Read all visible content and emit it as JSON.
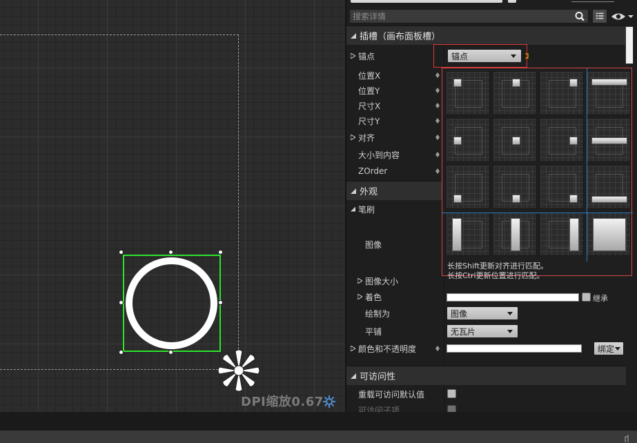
{
  "designer": {
    "dpi_label": "DPI缩放0.67",
    "settings_icon": "gear-icon",
    "anchor_icon": "anchor-flower-icon"
  },
  "details": {
    "search": {
      "placeholder": "搜索详情"
    },
    "icons": {
      "search": "search-icon",
      "view_options": "grid-icon",
      "visibility": "eye-icon"
    },
    "sections": {
      "slot": "插槽（画布面板槽）",
      "appearance": "外观",
      "accessibility": "可访问性"
    },
    "slot_rows": {
      "anchors": {
        "label": "锚点",
        "dropdown": "锚点"
      },
      "position_x": "位置X",
      "position_y": "位置Y",
      "size_x": "尺寸X",
      "size_y": "尺寸Y",
      "alignment": "对齐",
      "size_to_content": "大小到内容",
      "zorder": "ZOrder"
    },
    "appearance_rows": {
      "brush": "笔刷",
      "image": "图像",
      "image_size": "图像大小",
      "tint": {
        "label": "着色",
        "inherit_label": "继承"
      },
      "draw_as": {
        "label": "绘制为",
        "value": "图像"
      },
      "tiling": {
        "label": "平铺",
        "value": "无瓦片"
      },
      "color_and_opacity": {
        "label": "颜色和不透明度",
        "bind_button": "绑定"
      }
    },
    "accessibility_rows": {
      "override_defaults": "重载可访问默认值",
      "children_accessible": "可访问子项"
    }
  },
  "anchor_popup": {
    "hint_line1": "长按Shift更新对齐进行匹配。",
    "hint_line2": "长按Ctrl更新位置进行匹配。",
    "presets": [
      {
        "name": "anchor-top-left"
      },
      {
        "name": "anchor-top-center"
      },
      {
        "name": "anchor-top-right"
      },
      {
        "name": "anchor-top-stretch"
      },
      {
        "name": "anchor-center-left"
      },
      {
        "name": "anchor-center"
      },
      {
        "name": "anchor-center-right"
      },
      {
        "name": "anchor-center-stretch"
      },
      {
        "name": "anchor-bottom-left"
      },
      {
        "name": "anchor-bottom-center"
      },
      {
        "name": "anchor-bottom-right"
      },
      {
        "name": "anchor-bottom-stretch"
      },
      {
        "name": "anchor-left-stretch"
      },
      {
        "name": "anchor-vcenter-stretch"
      },
      {
        "name": "anchor-right-stretch"
      },
      {
        "name": "anchor-fill"
      }
    ]
  },
  "colors": {
    "selection": "#2ee52e",
    "highlight": "#e03535",
    "guide": "#2c7fc4"
  }
}
